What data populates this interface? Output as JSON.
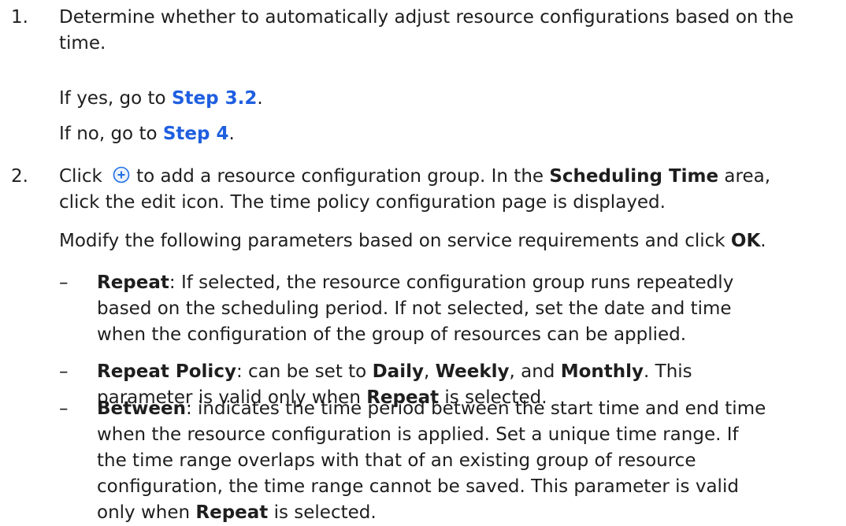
{
  "step1": {
    "number": "1.",
    "text": "Determine whether to automatically adjust resource configurations based on the time.",
    "yes_prefix": "If yes, go to ",
    "yes_link": "Step 3.2",
    "yes_suffix": ".",
    "no_prefix": "If no, go to ",
    "no_link": "Step 4",
    "no_suffix": "."
  },
  "step2": {
    "number": "2.",
    "click": "Click",
    "line1_after_icon": "to add a resource configuration group. In the ",
    "scheduling_time": "Scheduling Time",
    "line1_end": " area,",
    "line2": "click the edit icon. The time policy configuration page is displayed.",
    "modify_prefix": "Modify the following parameters based on service requirements and click ",
    "ok": "OK",
    "modify_suffix": ".",
    "icon": "add-circle-icon",
    "icon_color": "#1f6fe6"
  },
  "params": [
    {
      "bullet": "–",
      "name": "Repeat",
      "lines": [
        ": If selected, the resource configuration group runs repeatedly",
        "based on the scheduling period. If not selected, set the date and time",
        "when the configuration of the group of resources can be applied."
      ]
    },
    {
      "bullet": "–",
      "name": "Repeat Policy",
      "mid1": ": can be set to ",
      "daily": "Daily",
      "sep1": ", ",
      "weekly": "Weekly",
      "sep2": ", and ",
      "monthly": "Monthly",
      "end1": ". This",
      "line2_prefix": "parameter is valid only when ",
      "repeat": "Repeat",
      "line2_suffix": " is selected."
    },
    {
      "bullet": "–",
      "name": "Between",
      "lines": [
        ": indicates the time period between the start time and end time",
        "when the resource configuration is applied. Set a unique time range. If",
        "the time range overlaps with that of an existing group of resource",
        "configuration, the time range cannot be saved. This parameter is valid"
      ],
      "last_prefix": "only when ",
      "repeat": "Repeat",
      "last_suffix": " is selected."
    }
  ]
}
